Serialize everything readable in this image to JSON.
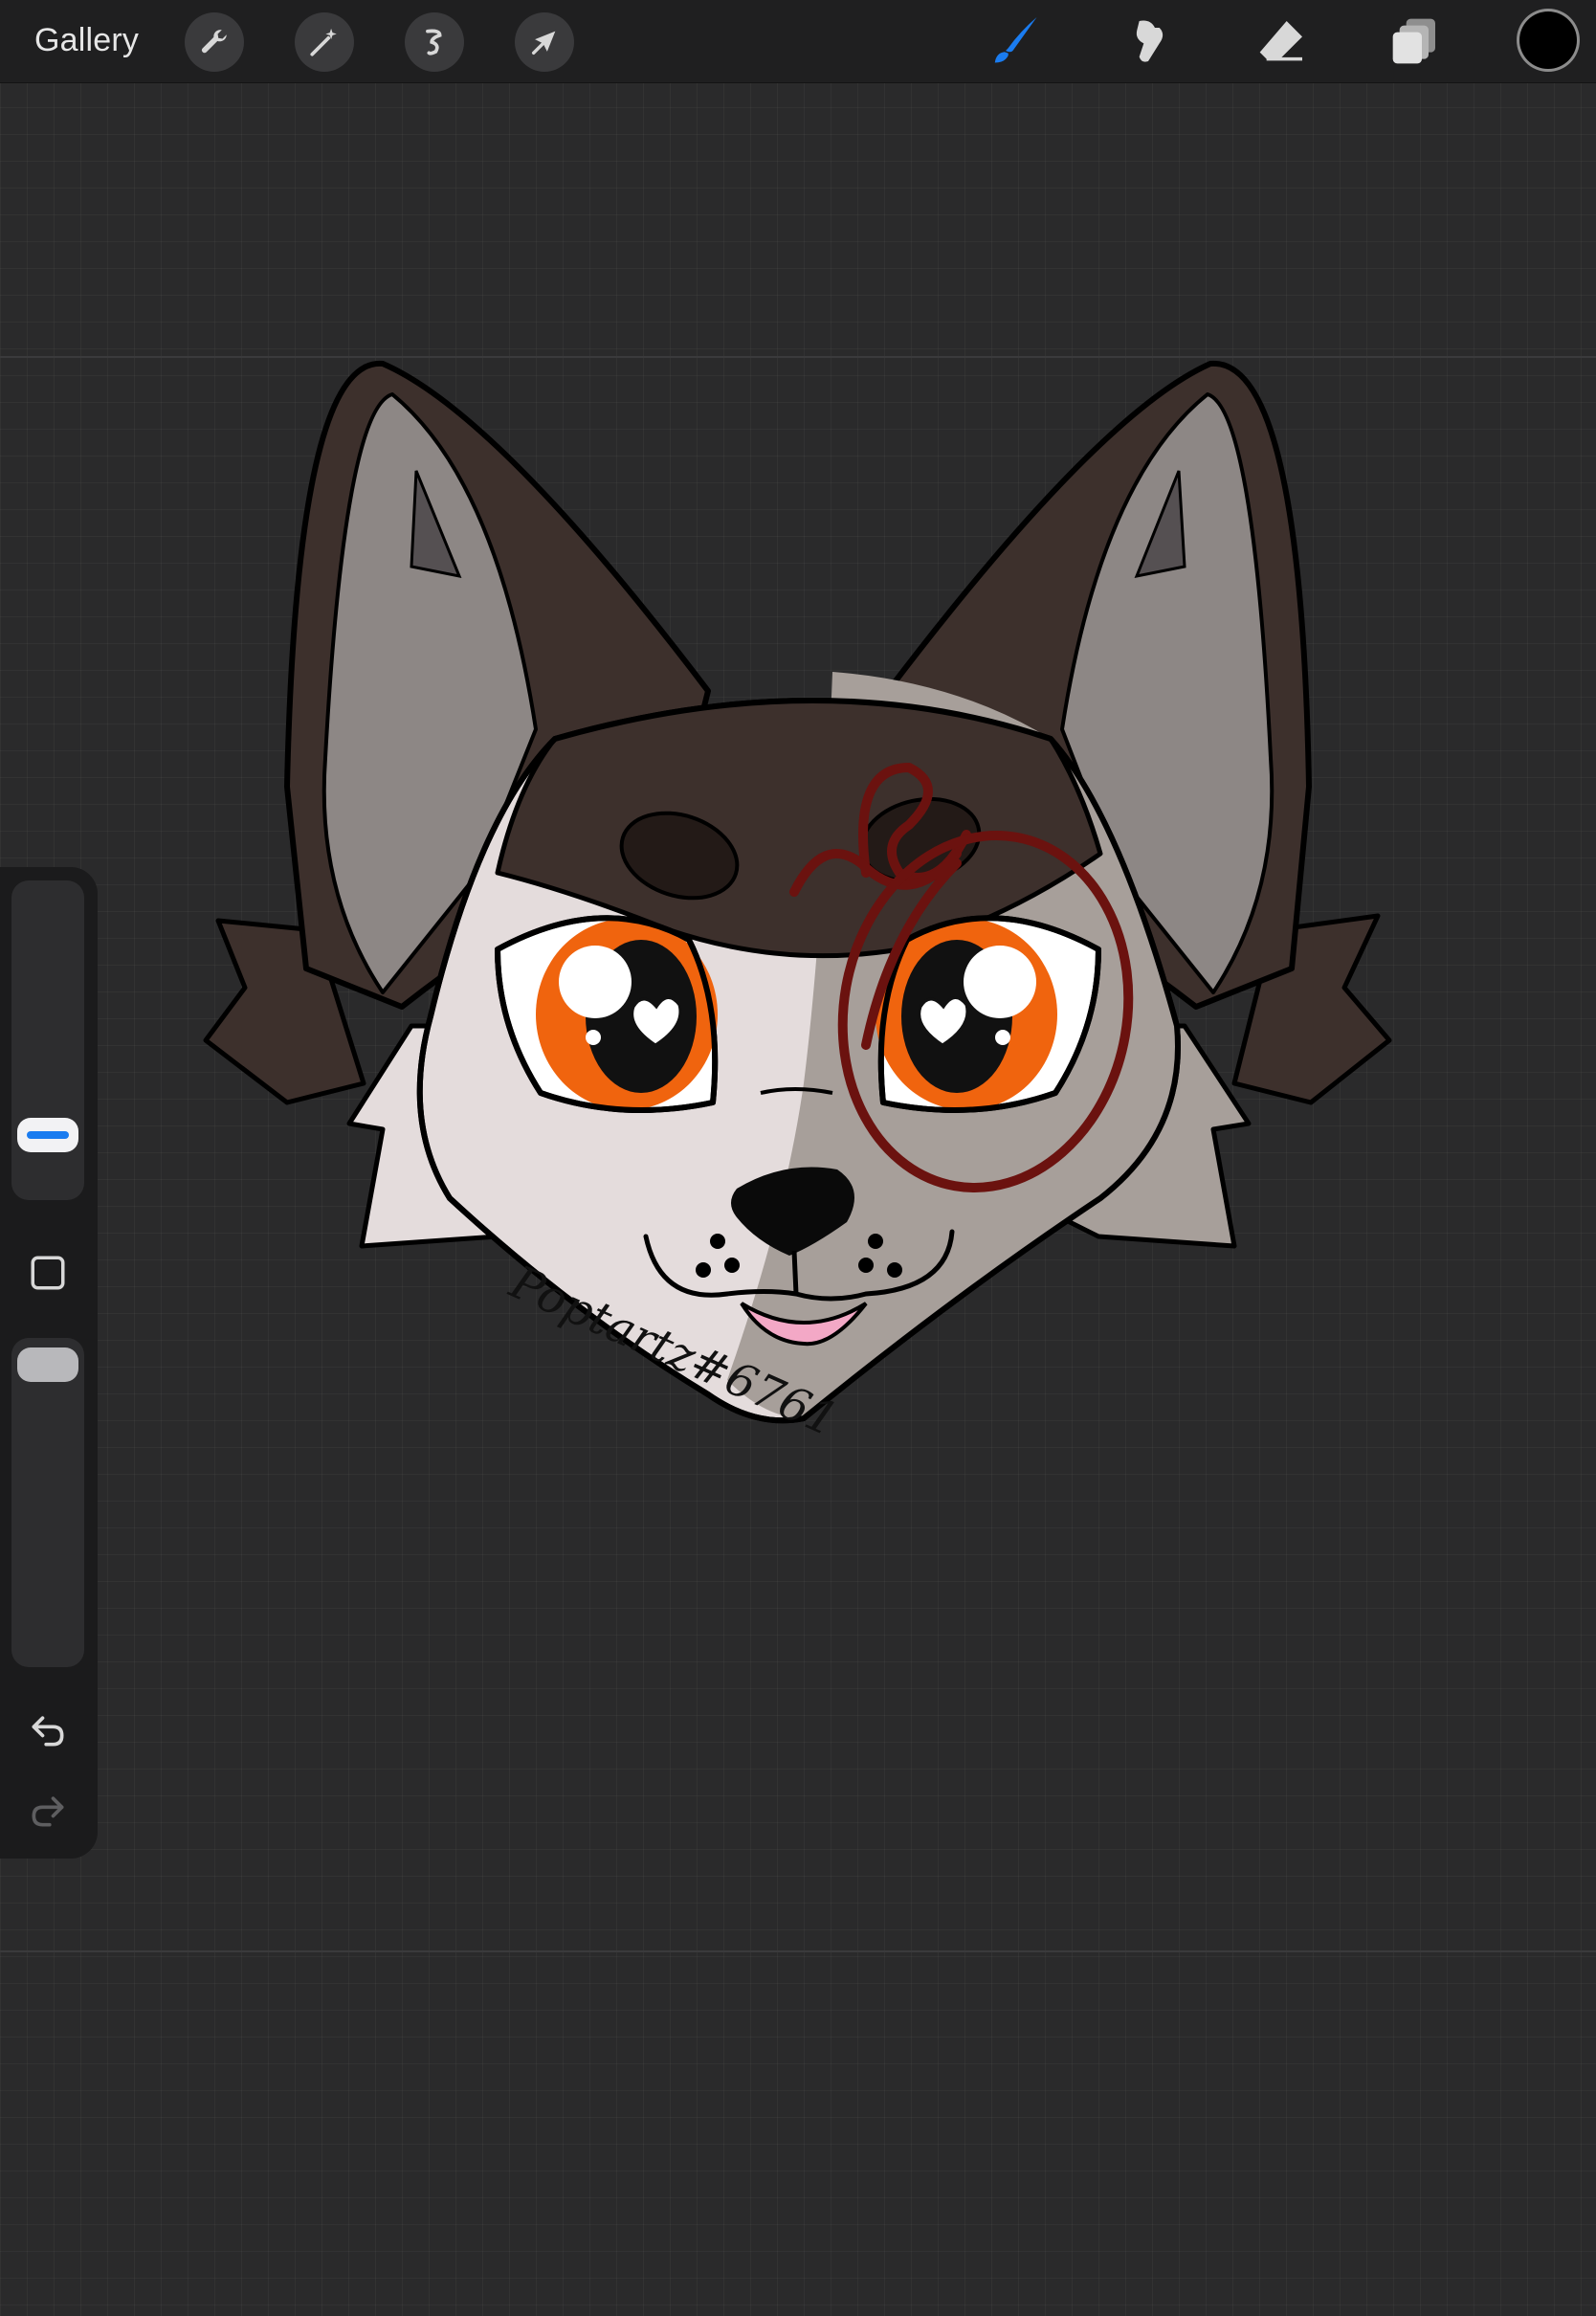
{
  "topbar": {
    "gallery_label": "Gallery",
    "left_tools": [
      {
        "icon": "wrench-icon",
        "label": "Actions"
      },
      {
        "icon": "magic-wand-icon",
        "label": "Adjustments"
      },
      {
        "icon": "selection-icon",
        "label": "Selection"
      },
      {
        "icon": "arrow-cursor-icon",
        "label": "Transform"
      }
    ],
    "right_tools": [
      {
        "icon": "brush-icon",
        "label": "Paint",
        "active": true
      },
      {
        "icon": "smudge-icon",
        "label": "Smudge",
        "active": false
      },
      {
        "icon": "eraser-icon",
        "label": "Erase",
        "active": false
      },
      {
        "icon": "layers-icon",
        "label": "Layers",
        "active": false
      }
    ],
    "current_color": "#000000"
  },
  "sidebar": {
    "brush_size": 0.3,
    "brush_opacity": 0.8,
    "buttons": [
      "modify-icon",
      "undo-icon",
      "redo-icon"
    ]
  },
  "artwork": {
    "signature": "Poptartz#6761",
    "colors": {
      "fur_dark": "#3d302c",
      "fur_light": "#e4dcdc",
      "fur_mid": "#a79f9a",
      "ear_inner": "#8d8785",
      "eye_orange": "#f0640e",
      "scribble": "#6b120f",
      "tongue": "#f3a8c6"
    }
  },
  "colors": {
    "accent": "#1a7cf0",
    "workspace": "#2a2a2b",
    "toolbar": "#1f1f20"
  }
}
